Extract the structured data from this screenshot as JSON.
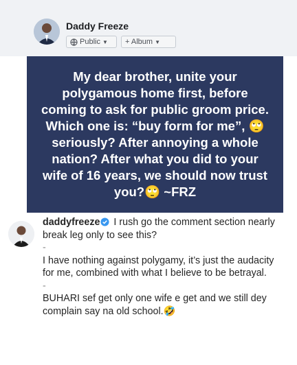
{
  "post": {
    "author": "Daddy Freeze",
    "privacy_label": "Public",
    "album_label": "+ Album",
    "icons": {
      "privacy": "globe-icon",
      "dropdown": "caret-down-icon",
      "verified": "verified-badge-icon",
      "avatar": "user-avatar-icon"
    },
    "colors": {
      "card_bg": "#2c3960",
      "card_text": "#ffffff",
      "verified": "#3897f0"
    }
  },
  "quote": {
    "text": "My dear brother, unite your polygamous home first, before coming to ask for public groom price. Which one is: “buy form for me”, 🙄seriously? After annoying a whole nation? After what you did to your wife of 16 years, we should now trust you?🙄 ~FRZ"
  },
  "caption": {
    "username": "daddyfreeze",
    "line1": "I rush go the comment section nearly break leg only to see this?",
    "separator": "-",
    "paragraph2": "I have nothing against polygamy, it’s just the audacity for me, combined with what I believe to be betrayal.",
    "paragraph3": "BUHARI sef get only one wife e get and we still dey complain say na old school.🤣"
  }
}
